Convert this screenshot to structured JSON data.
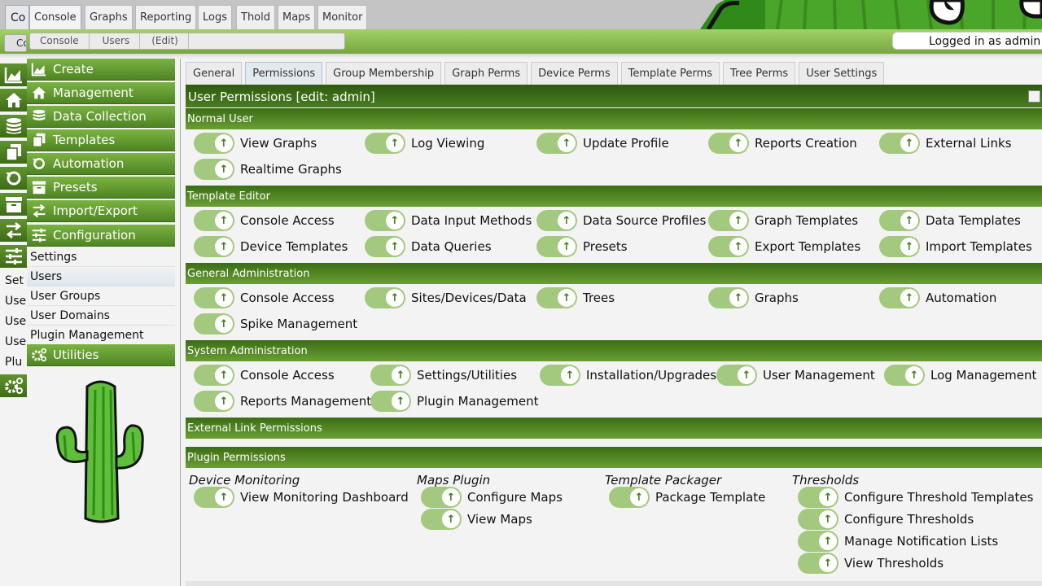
{
  "top_nav": {
    "ghost_tab": "Co",
    "tabs": [
      "Console",
      "Graphs",
      "Reporting",
      "Logs",
      "Thold",
      "Maps",
      "Monitor"
    ]
  },
  "breadcrumb": {
    "ghost": "Co",
    "items": [
      "Console",
      "Users",
      "(Edit)"
    ]
  },
  "login_text": "Logged in as admin",
  "sidebar": {
    "menus": [
      {
        "label": "Create",
        "icon": "area-chart-icon"
      },
      {
        "label": "Management",
        "icon": "home-icon"
      },
      {
        "label": "Data Collection",
        "icon": "database-icon"
      },
      {
        "label": "Templates",
        "icon": "copy-icon"
      },
      {
        "label": "Automation",
        "icon": "refresh-icon"
      },
      {
        "label": "Presets",
        "icon": "archive-icon"
      },
      {
        "label": "Import/Export",
        "icon": "exchange-icon"
      },
      {
        "label": "Configuration",
        "icon": "sliders-icon"
      }
    ],
    "config_items": [
      "Settings",
      "Users",
      "User Groups",
      "User Domains",
      "Plugin Management"
    ],
    "utilities_label": "Utilities",
    "ghost_items": [
      "Set",
      "Use",
      "Use",
      "Use",
      "Plu"
    ]
  },
  "tabs": [
    "General",
    "Permissions",
    "Group Membership",
    "Graph Perms",
    "Device Perms",
    "Template Perms",
    "Tree Perms",
    "User Settings"
  ],
  "active_tab": "Permissions",
  "panel_title": "User Permissions [edit: admin]",
  "sections": {
    "normal_user": {
      "title": "Normal User",
      "perms": [
        "View Graphs",
        "Log Viewing",
        "Update Profile",
        "Reports Creation",
        "External Links",
        "Realtime Graphs"
      ]
    },
    "template_editor": {
      "title": "Template Editor",
      "perms": [
        "Console Access",
        "Data Input Methods",
        "Data Source Profiles",
        "Graph Templates",
        "Data Templates",
        "Device Templates",
        "Data Queries",
        "Presets",
        "Export Templates",
        "Import Templates"
      ]
    },
    "general_admin": {
      "title": "General Administration",
      "perms": [
        "Console Access",
        "Sites/Devices/Data",
        "Trees",
        "Graphs",
        "Automation",
        "Spike Management"
      ]
    },
    "system_admin": {
      "title": "System Administration",
      "perms": [
        "Console Access",
        "Settings/Utilities",
        "Installation/Upgrades",
        "User Management",
        "Log Management",
        "Reports Management",
        "Plugin Management"
      ]
    },
    "external_link": {
      "title": "External Link Permissions"
    },
    "plugin": {
      "title": "Plugin Permissions",
      "groups": [
        {
          "name": "Device Monitoring",
          "perms": [
            "View Monitoring Dashboard"
          ]
        },
        {
          "name": "Maps Plugin",
          "perms": [
            "Configure Maps",
            "View Maps"
          ]
        },
        {
          "name": "Template Packager",
          "perms": [
            "Package Template"
          ]
        },
        {
          "name": "Thresholds",
          "perms": [
            "Configure Threshold Templates",
            "Configure Thresholds",
            "Manage Notification Lists",
            "View Thresholds"
          ]
        }
      ]
    }
  },
  "colors": {
    "accent_green": "#4f8423",
    "header_dark_green": "#2e5a0e",
    "toggle_on": "#a3c97f"
  }
}
